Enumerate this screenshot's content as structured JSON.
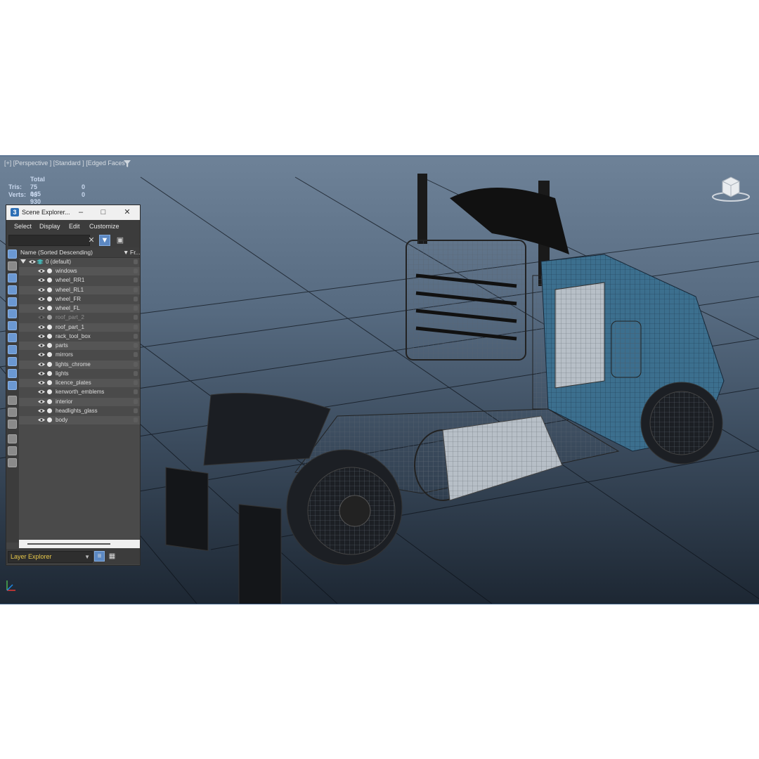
{
  "viewport": {
    "label": "[+] [Perspective ] [Standard ] [Edged Faces ]",
    "stats": {
      "header": "Total",
      "tris_label": "Tris:",
      "tris_value": "75 045",
      "tris_sel": "0",
      "verts_label": "Verts:",
      "verts_value": "43 930",
      "verts_sel": "0"
    },
    "viewcube_icon": "viewcube-icon",
    "background_top": "#6e8298",
    "background_bottom": "#1d2733"
  },
  "panel": {
    "title": "Scene Explorer...",
    "menu": [
      "Select",
      "Display",
      "Edit",
      "Customize"
    ],
    "search": {
      "value": "",
      "placeholder": ""
    },
    "column_name": "Name (Sorted Descending)",
    "column_frozen": "Fr...",
    "root_layer": "0 (default)",
    "layers": [
      {
        "name": "windows",
        "visible": true
      },
      {
        "name": "wheel_RR1",
        "visible": true
      },
      {
        "name": "wheel_RL1",
        "visible": true
      },
      {
        "name": "wheel_FR",
        "visible": true
      },
      {
        "name": "wheel_FL",
        "visible": true
      },
      {
        "name": "roof_part_2",
        "visible": false
      },
      {
        "name": "roof_part_1",
        "visible": true
      },
      {
        "name": "rack_tool_box",
        "visible": true
      },
      {
        "name": "parts",
        "visible": true
      },
      {
        "name": "mirrors",
        "visible": true
      },
      {
        "name": "lights_chrome",
        "visible": true
      },
      {
        "name": "lights",
        "visible": true
      },
      {
        "name": "licence_plates",
        "visible": true
      },
      {
        "name": "kenworth_emblems",
        "visible": true
      },
      {
        "name": "interior",
        "visible": true
      },
      {
        "name": "headlights_glass",
        "visible": true
      },
      {
        "name": "body",
        "visible": true
      }
    ],
    "explorer_mode": "Layer Explorer",
    "accent": "#5c88c2"
  }
}
